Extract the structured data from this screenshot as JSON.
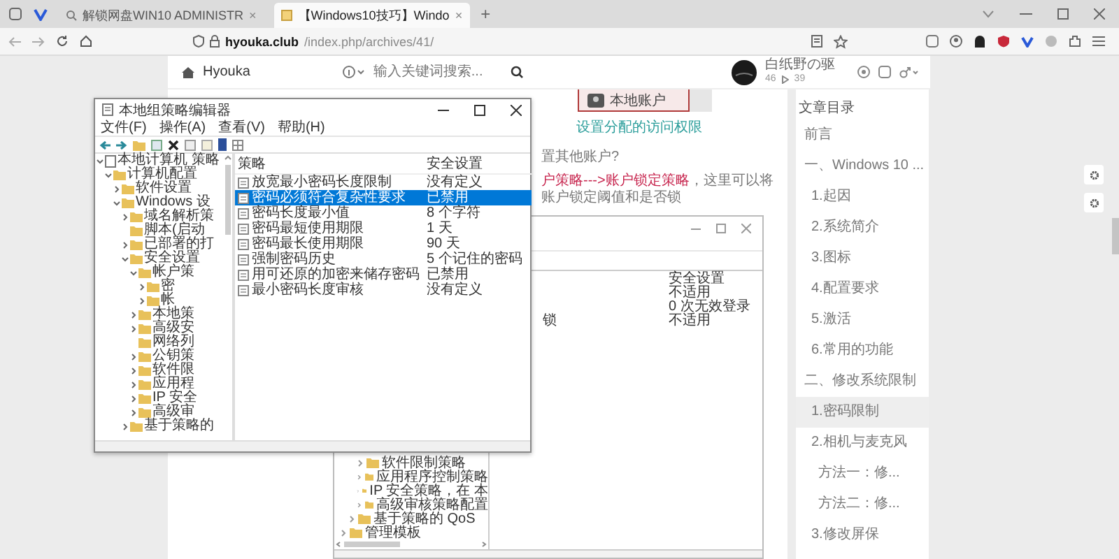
{
  "browser": {
    "tabs": [
      {
        "title": "解锁网盘WIN10 ADMINISTR",
        "close": "×",
        "selected": false
      },
      {
        "title": "【Windows10技巧】Windo",
        "close": "×",
        "selected": true
      }
    ],
    "new_tab": "+",
    "url_host": "hyouka.club",
    "url_path": "/index.php/archives/41/"
  },
  "site_header": {
    "logo": "Hyouka",
    "search": {
      "placeholder": "输入关键词搜索..."
    },
    "user": {
      "name": "白纸野の驱",
      "stat_1": "46",
      "stat_2": "39"
    }
  },
  "article": {
    "image_caption": "本地账户",
    "link": "设置分配的访问权限",
    "line_1": "置其他账户?",
    "line_2_highlight": "户策略--->账户锁定策略",
    "line_2_text": "，这里可以将账户锁定阈值和是否锁",
    "screenshot": {
      "column_header": "安全设置",
      "rows": [
        {
          "setting": "不适用"
        },
        {
          "setting": "0 次无效登录"
        },
        {
          "name": "锁",
          "setting": "不适用"
        }
      ],
      "tree": [
        {
          "children": [
            {
              "children": [
                {
                  "label": "软件限制策略",
                  "expanded": false
                },
                {
                  "label": "应用程序控制策略",
                  "expanded": false
                },
                {
                  "label": "IP 安全策略，在 本",
                  "expanded": false
                },
                {
                  "label": "高级审核策略配置",
                  "expanded": false
                }
              ]
            },
            {
              "label": "基于策略的 QoS",
              "expanded": false
            }
          ]
        },
        {
          "label": "管理模板",
          "expanded": false
        }
      ]
    }
  },
  "mmc": {
    "title": "本地组策略编辑器",
    "menu": [
      "文件(F)",
      "操作(A)",
      "查看(V)",
      "帮助(H)"
    ],
    "tree": [
      {
        "label": "本地计算机 策略",
        "expanded": true,
        "children": [
          {
            "label": "计算机配置",
            "expanded": true,
            "children": [
              {
                "label": "软件设置",
                "expanded": false
              },
              {
                "label": "Windows 设",
                "expanded": true,
                "children": [
                  {
                    "label": "域名解析策",
                    "expanded": false
                  },
                  {
                    "label": "脚本(启动"
                  },
                  {
                    "label": "已部署的打",
                    "expanded": false
                  },
                  {
                    "label": "安全设置",
                    "expanded": true,
                    "children": [
                      {
                        "label": "帐户策",
                        "expanded": true,
                        "children": [
                          {
                            "label": "密",
                            "expanded": false
                          },
                          {
                            "label": "帐",
                            "expanded": false
                          }
                        ]
                      },
                      {
                        "label": "本地策",
                        "expanded": false
                      },
                      {
                        "label": "高级安",
                        "expanded": false
                      },
                      {
                        "label": "网络列"
                      },
                      {
                        "label": "公钥策",
                        "expanded": false
                      },
                      {
                        "label": "软件限",
                        "expanded": false
                      },
                      {
                        "label": "应用程",
                        "expanded": false
                      },
                      {
                        "label": "IP 安全",
                        "expanded": false
                      },
                      {
                        "label": "高级审",
                        "expanded": false
                      }
                    ]
                  },
                  {
                    "label": "基于策略的",
                    "expanded": false
                  }
                ]
              }
            ]
          }
        ]
      }
    ],
    "columns": [
      "策略",
      "安全设置"
    ],
    "rows": [
      {
        "name": "放宽最小密码长度限制",
        "setting": "没有定义",
        "selected": false
      },
      {
        "name": "密码必须符合复杂性要求",
        "setting": "已禁用",
        "selected": true
      },
      {
        "name": "密码长度最小值",
        "setting": "8 个字符",
        "selected": false
      },
      {
        "name": "密码最短使用期限",
        "setting": "1 天",
        "selected": false
      },
      {
        "name": "密码最长使用期限",
        "setting": "90 天",
        "selected": false
      },
      {
        "name": "强制密码历史",
        "setting": "5 个记住的密码",
        "selected": false
      },
      {
        "name": "用可还原的加密来储存密码",
        "setting": "已禁用",
        "selected": false
      },
      {
        "name": "最小密码长度审核",
        "setting": "没有定义",
        "selected": false
      }
    ]
  },
  "toc": {
    "title": "文章目录",
    "items": [
      {
        "label": "前言",
        "selected": false
      },
      {
        "label": "一、Windows 10 ...",
        "selected": false,
        "children": [
          {
            "label": "1.起因",
            "selected": false
          },
          {
            "label": "2.系统简介",
            "selected": false
          },
          {
            "label": "3.图标",
            "selected": false
          },
          {
            "label": "4.配置要求",
            "selected": false
          },
          {
            "label": "5.激活",
            "selected": false
          },
          {
            "label": "6.常用的功能",
            "selected": false
          }
        ]
      },
      {
        "label": "二、修改系统限制",
        "selected": false,
        "children": [
          {
            "label": "1.密码限制",
            "selected": true
          },
          {
            "label": "2.相机与麦克风",
            "selected": false,
            "children": [
              {
                "label": "方法一：修...",
                "selected": false
              },
              {
                "label": "方法二：修...",
                "selected": false
              }
            ]
          },
          {
            "label": "3.修改屏保",
            "selected": false
          }
        ]
      }
    ]
  }
}
